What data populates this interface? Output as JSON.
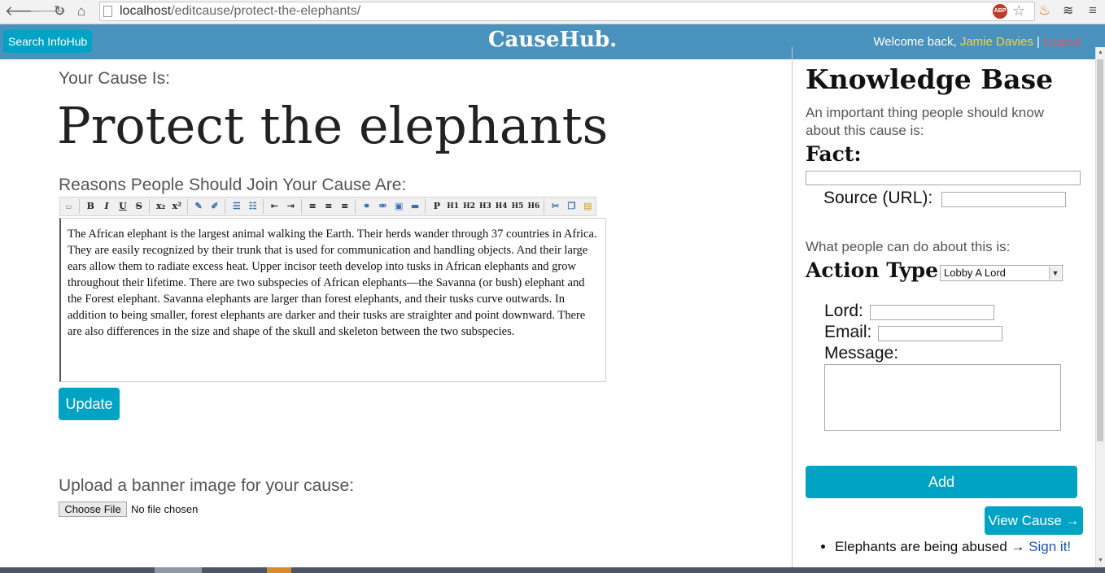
{
  "browser": {
    "url_host": "localhost",
    "url_path": "/editcause/protect-the-elephants/",
    "abp_label": "ABP",
    "icons": [
      "back-icon",
      "forward-icon",
      "reload-icon",
      "home-icon",
      "page-icon",
      "adblock-icon",
      "bookmark-star-icon",
      "extension-icon",
      "layers-icon",
      "menu-icon"
    ]
  },
  "header": {
    "search_button": "Search InfoHub",
    "brand": "CauseHub.",
    "welcome_prefix": "Welcome back, ",
    "user_name": "Jamie Davies",
    "separator": "|",
    "logout": "Logout"
  },
  "main": {
    "cause_label": "Your Cause Is:",
    "cause_title": "Protect the elephants",
    "reasons_label": "Reasons People Should Join Your Cause Are:",
    "editor_toolbar": {
      "bold": "B",
      "italic": "I",
      "underline": "U",
      "strike": "S",
      "subscript": "x₂",
      "superscript": "x²",
      "paragraph": "P",
      "h1": "H1",
      "h2": "H2",
      "h3": "H3",
      "h4": "H4",
      "h5": "H5",
      "h6": "H6"
    },
    "editor_text": "The African elephant is the largest animal walking the Earth. Their herds wander through 37 countries in Africa. They are easily recognized by their trunk that is used for communication and handling objects. And their large ears allow them to radiate excess heat. Upper incisor teeth develop into tusks in African elephants and grow throughout their lifetime. There are two subspecies of African elephants—the Savanna (or bush) elephant and the Forest elephant. Savanna elephants are larger than forest elephants, and their tusks curve outwards. In addition to being smaller, forest elephants are darker and their tusks are straighter and point downward. There are also differences in the size and shape of the skull and skeleton between the two subspecies.",
    "update_button": "Update",
    "upload_label": "Upload a banner image for your cause:",
    "choose_file_button": "Choose File",
    "no_file_text": "No file chosen"
  },
  "knowledge_base": {
    "title": "Knowledge Base",
    "intro": "An important thing people should know about this cause is:",
    "fact_label": "Fact:",
    "fact_value": "",
    "source_label": "Source (URL):",
    "source_value": "",
    "action_intro": "What people can do about this is:",
    "action_label": "Action Type:",
    "action_selected": "Lobby A Lord",
    "lord_label": "Lord:",
    "email_label": "Email:",
    "message_label": "Message:",
    "add_button": "Add",
    "view_cause_button": "View Cause →",
    "items": [
      {
        "text": "Elephants are being abused → ",
        "link": "Sign it!"
      }
    ]
  },
  "colors": {
    "header_bg": "#4a92be",
    "button_primary": "#00a3c4",
    "user_name": "#f5d33a",
    "logout": "#e8505b",
    "link": "#1a55b5"
  }
}
